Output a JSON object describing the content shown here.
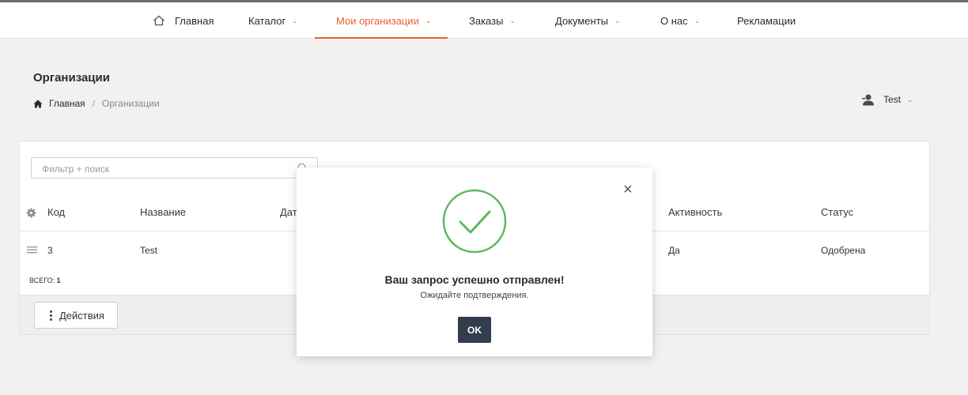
{
  "nav": {
    "items": [
      {
        "label": "Главная",
        "icon": "home-icon"
      },
      {
        "label": "Каталог",
        "dropdown": true
      },
      {
        "label": "Мои организации",
        "dropdown": true,
        "active": true
      },
      {
        "label": "Заказы",
        "dropdown": true
      },
      {
        "label": "Документы",
        "dropdown": true
      },
      {
        "label": "О нас",
        "dropdown": true
      },
      {
        "label": "Рекламации"
      }
    ],
    "accent_color": "#ea5d36"
  },
  "page": {
    "title": "Организации",
    "breadcrumb": {
      "home": "Главная",
      "separator": "/",
      "current": "Организации"
    }
  },
  "user": {
    "name": "Test"
  },
  "table": {
    "search_placeholder": "Фильтр + поиск",
    "columns": {
      "code": "Код",
      "name": "Название",
      "date": "Дат",
      "activity": "Активность",
      "status": "Статус"
    },
    "rows": [
      {
        "code": "3",
        "name": "Test",
        "activity": "Да",
        "status": "Одобрена"
      }
    ],
    "total_label": "ВСЕГО:",
    "total_value": "1",
    "actions_label": "Действия"
  },
  "modal": {
    "title": "Ваш запрос успешно отправлен!",
    "subtitle": "Ожидайте подтверждения.",
    "ok_label": "OK",
    "close_label": "×",
    "success_color": "#5cb85c",
    "button_color": "#333d4d"
  }
}
